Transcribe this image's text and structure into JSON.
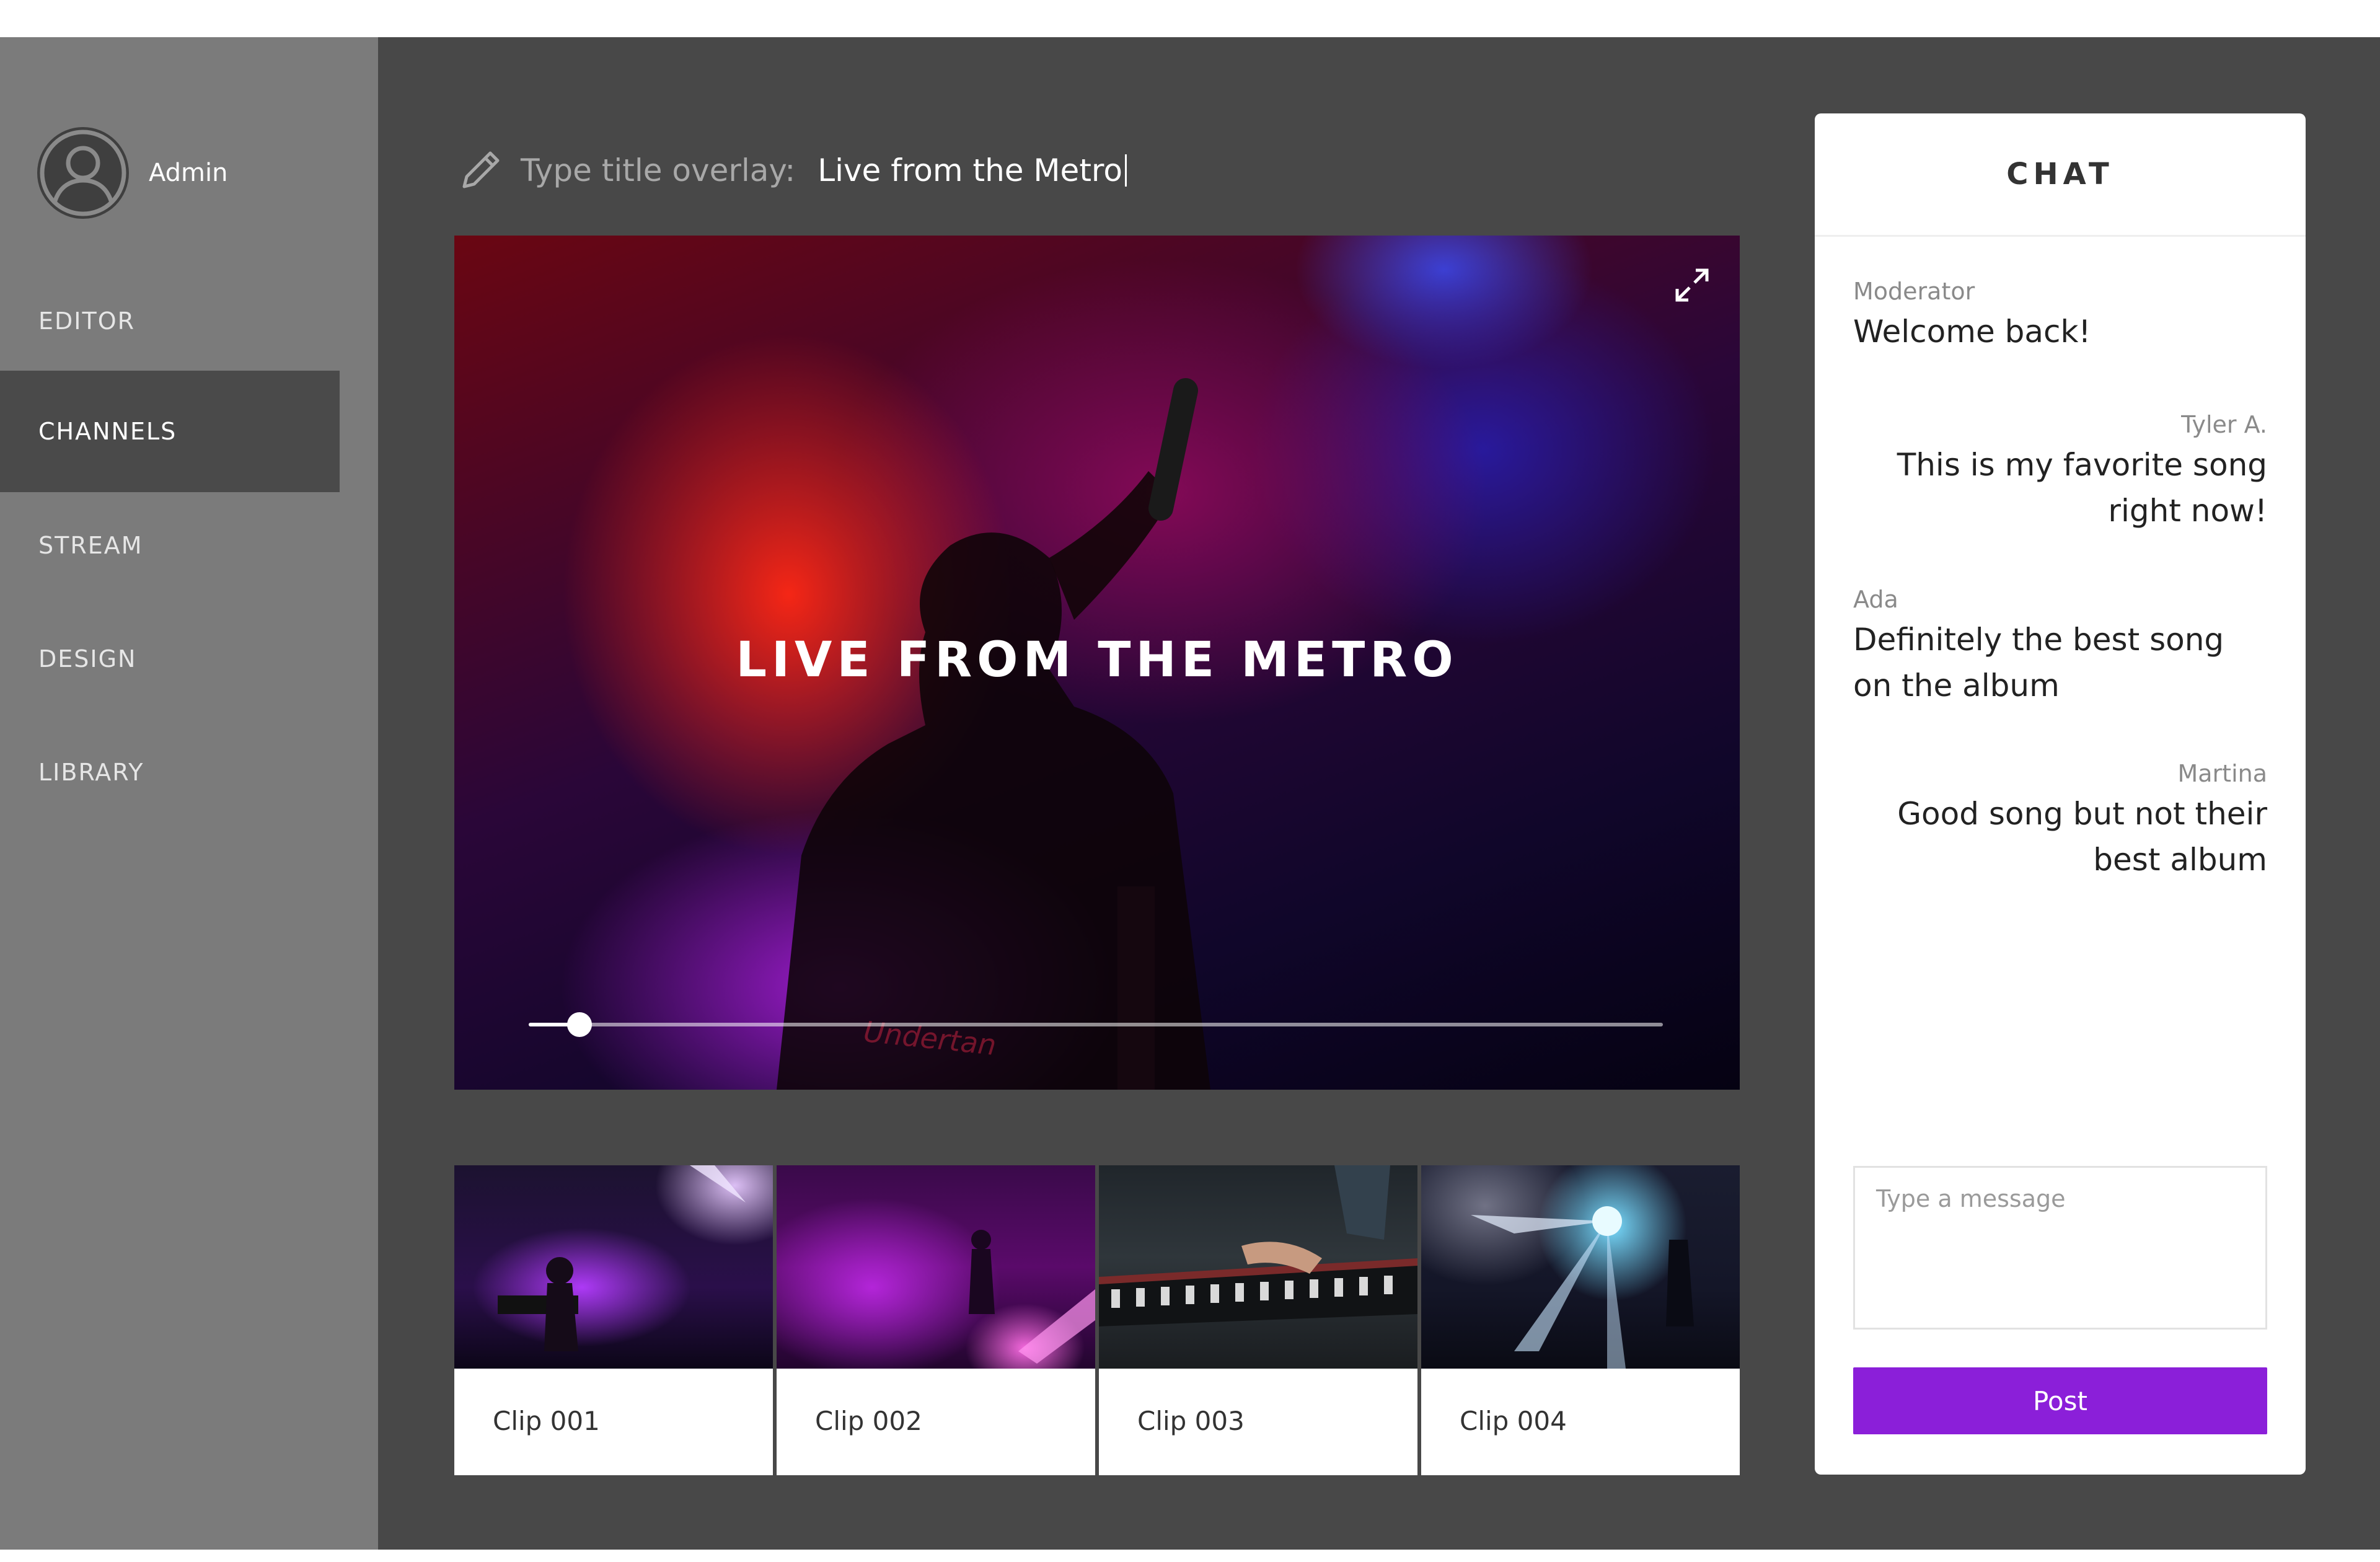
{
  "user": {
    "name": "Admin",
    "avatar_icon": "user-avatar-icon"
  },
  "nav": {
    "items": [
      {
        "label": "EDITOR",
        "active": false
      },
      {
        "label": "CHANNELS",
        "active": true
      },
      {
        "label": "STREAM",
        "active": false
      },
      {
        "label": "DESIGN",
        "active": false
      },
      {
        "label": "LIBRARY",
        "active": false
      }
    ]
  },
  "title_overlay": {
    "label": "Type title overlay:",
    "value": "Live from the Metro",
    "icon": "pencil-icon"
  },
  "video": {
    "overlay_text": "LIVE FROM THE METRO",
    "progress": 0.045,
    "brand_mark": "Undertan",
    "expand_icon": "expand-icon"
  },
  "clips": [
    {
      "label": "Clip 001"
    },
    {
      "label": "Clip 002"
    },
    {
      "label": "Clip 003"
    },
    {
      "label": "Clip 004"
    }
  ],
  "chat": {
    "title": "CHAT",
    "messages": [
      {
        "author": "Moderator",
        "text": "Welcome back!",
        "align": "left"
      },
      {
        "author": "Tyler A.",
        "text": "This is my favorite song right now!",
        "align": "right"
      },
      {
        "author": "Ada",
        "text": "Definitely the best song on the album",
        "align": "left"
      },
      {
        "author": "Martina",
        "text": "Good song but not their best album",
        "align": "right"
      }
    ],
    "input_placeholder": "Type a message",
    "post_label": "Post"
  },
  "colors": {
    "sidebar": "#7b7b7b",
    "main_bg": "#484848",
    "accent": "#8b1fd9",
    "active_nav": "#4a4a4a"
  }
}
